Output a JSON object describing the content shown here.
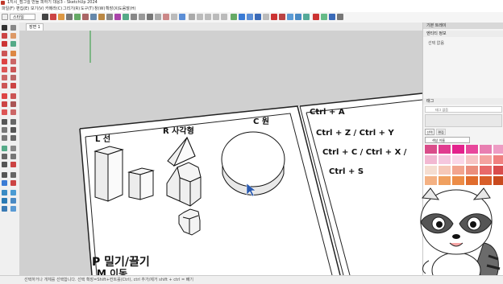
{
  "title": "1지시_점그릴 만들 피하기 대응3  - SketchUp 2024",
  "menu": [
    "파일(F)",
    "편집(E)",
    "보기(V)",
    "카메라(C)",
    "그리기(R)",
    "도구(T)",
    "창(W)",
    "확장(X)",
    "도움말(H)"
  ],
  "style_dropdown": "스타일",
  "scene_tab": "장면 1",
  "viewport": {
    "label_L": "L 선",
    "label_R": "R 사각형",
    "label_C": "C 원",
    "label_P": "P 밀기/끌기",
    "label_P2": "M 이동",
    "shortcuts": [
      "Ctrl + A",
      "Ctrl + Z  /  Ctrl + Y",
      "Ctrl + C  /  Ctrl + X  /",
      "Ctrl + S"
    ]
  },
  "panel": {
    "tray_title": "기본 트레이",
    "entity_header": "엔티티 정보",
    "entity_text": "선택 없음",
    "tag_header": "태그",
    "tag_value": "태그 없음",
    "materials_header": "재료",
    "tab_select": "선택",
    "tab_edit": "편집",
    "material_dropdown": "색상 이름",
    "swatches": [
      "#d94d8a",
      "#e03b8f",
      "#e3228c",
      "#e8489c",
      "#e87fb1",
      "#ed9cc4",
      "#f2b8d2",
      "#f5c7de",
      "#fad7e8",
      "#f7c4c4",
      "#f4a3a0",
      "#f08080",
      "#f5ddd0",
      "#f6c8b8",
      "#f2a48e",
      "#eb8e7c",
      "#e86a6a",
      "#d94c4c",
      "#f4b183",
      "#f0a060",
      "#ec8c47",
      "#e06c2d",
      "#d85e2a",
      "#c94a1e"
    ]
  },
  "status": "선택하거나 개체를 선택합니다. 선택 확장=Shift+컨트롤(Ctrl), ctrl 추가/제거 shift + ctrl = 빼기"
}
